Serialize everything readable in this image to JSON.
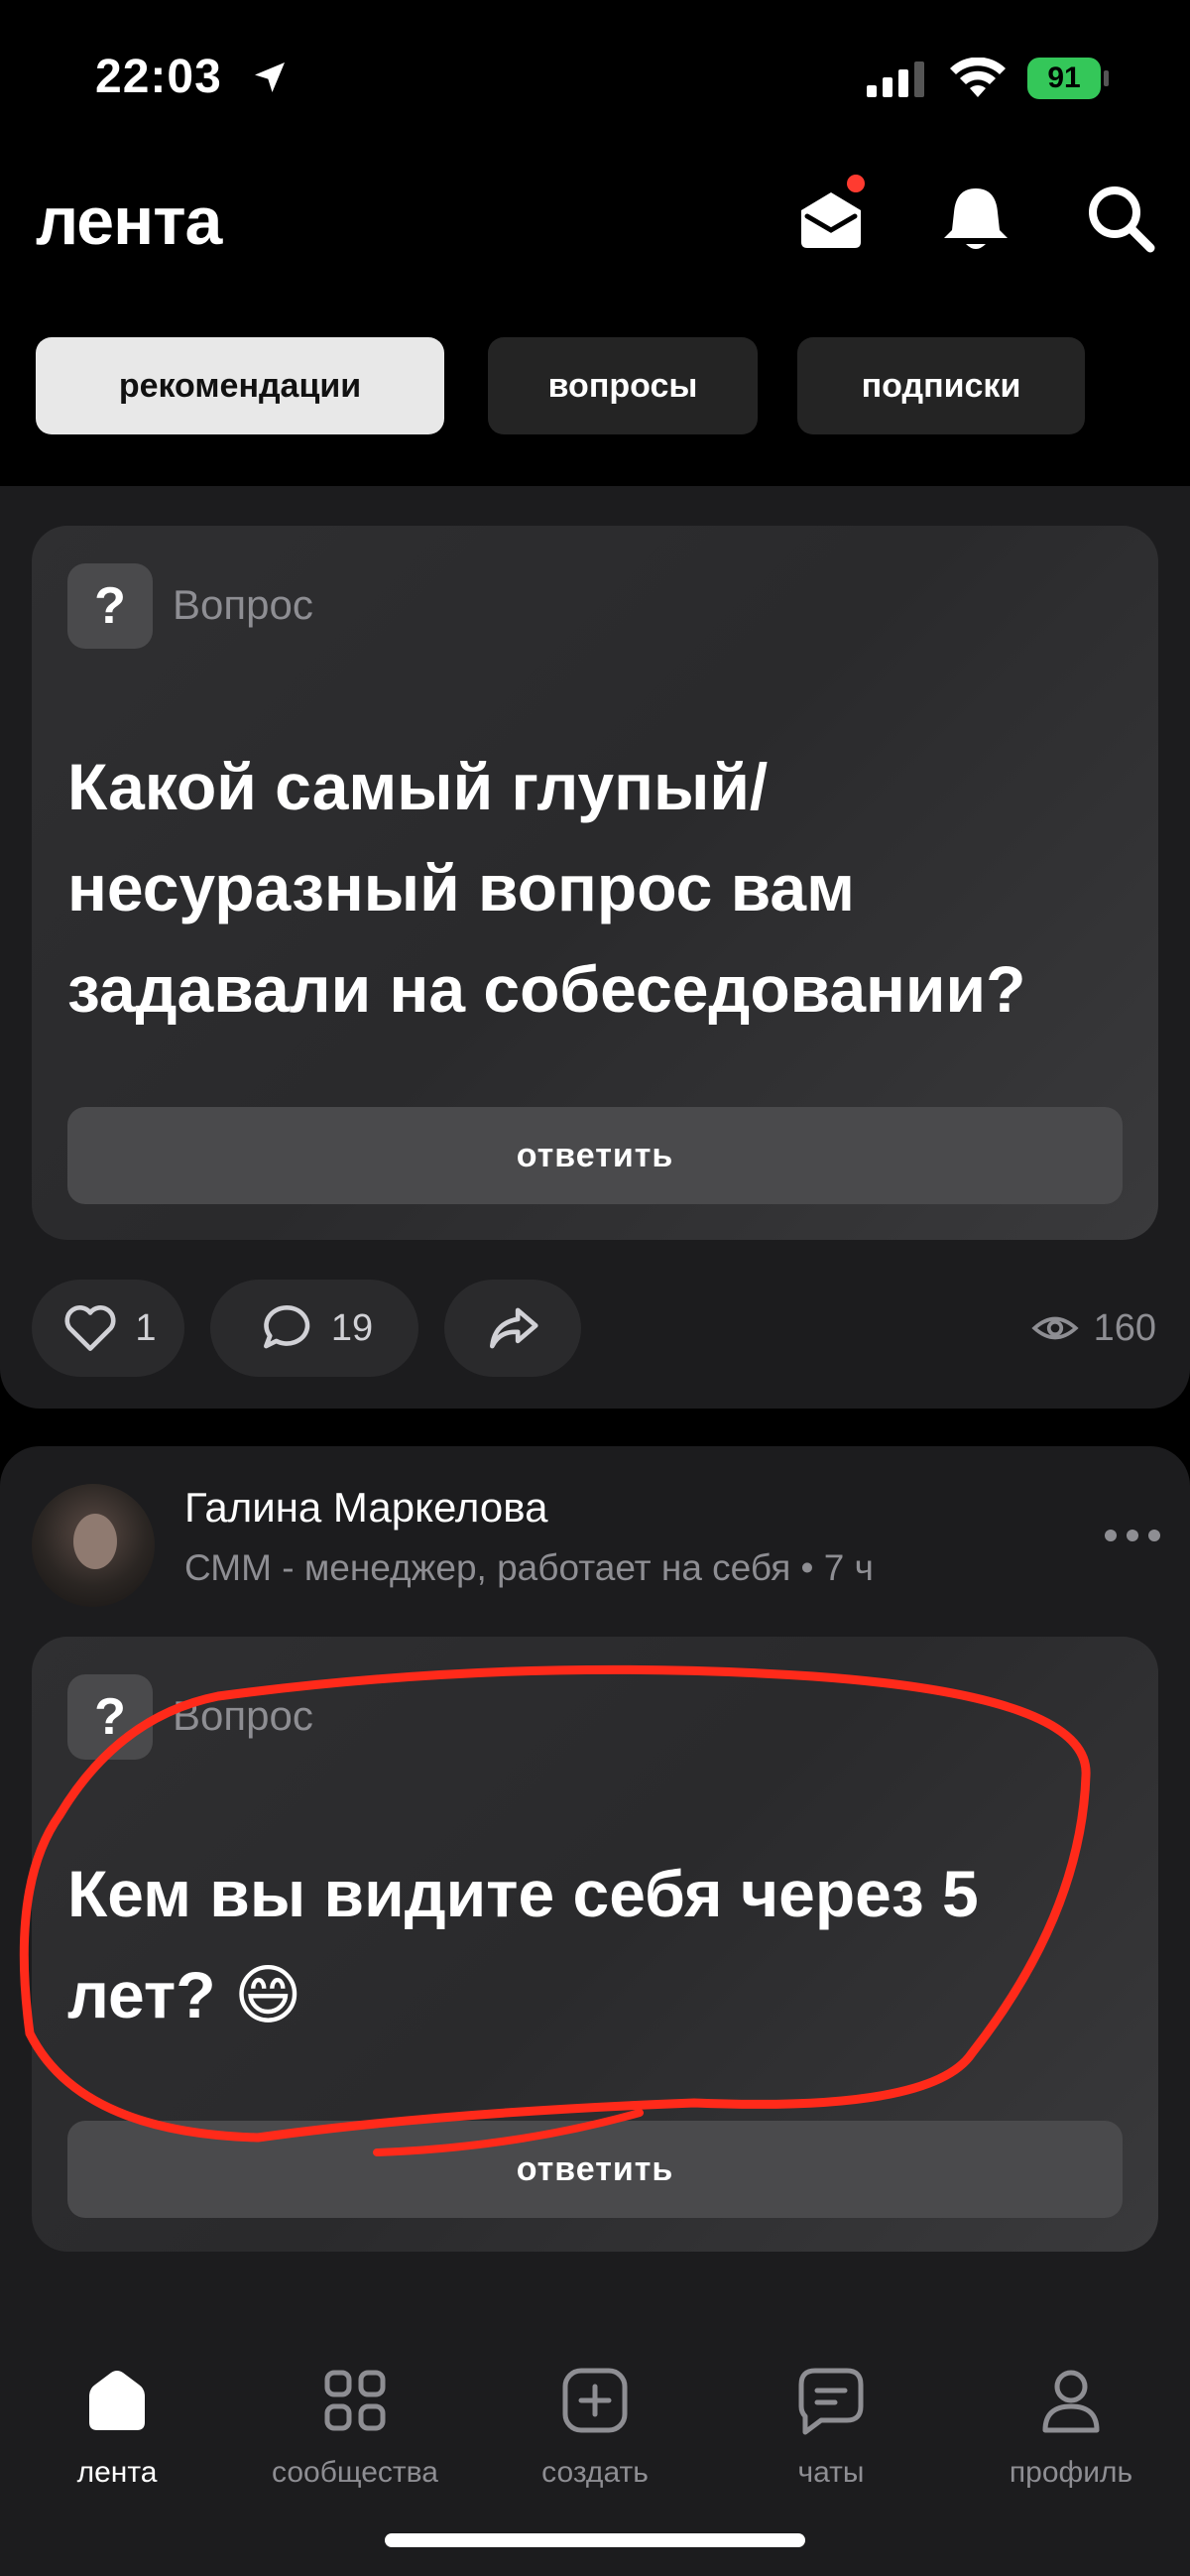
{
  "status_bar": {
    "time": "22:03",
    "battery": "91"
  },
  "header": {
    "logo": "лента",
    "tabs": [
      {
        "label": "рекомендации",
        "active": true
      },
      {
        "label": "вопросы",
        "active": false
      },
      {
        "label": "подписки",
        "active": false
      }
    ]
  },
  "posts": [
    {
      "type_label": "Вопрос",
      "badge": "?",
      "question": "Какой самый глупый/ несуразный вопрос вам задавали на собеседовании?",
      "answer_label": "ответить",
      "likes": "1",
      "comments": "19",
      "views": "160"
    },
    {
      "author": "Галина Маркелова",
      "author_sub": "СММ - менеджер, работает на себя • 7 ч",
      "type_label": "Вопрос",
      "badge": "?",
      "question": "Кем вы видите себя через 5 лет? 😄",
      "answer_label": "ответить"
    }
  ],
  "bottom_nav": [
    {
      "label": "лента",
      "icon": "home-icon",
      "active": true
    },
    {
      "label": "сообщества",
      "icon": "grid-icon",
      "active": false
    },
    {
      "label": "создать",
      "icon": "plus-square-icon",
      "active": false
    },
    {
      "label": "чаты",
      "icon": "chat-icon",
      "active": false
    },
    {
      "label": "профиль",
      "icon": "profile-icon",
      "active": false
    }
  ],
  "colors": {
    "background": "#000000",
    "card": "#1c1c1e",
    "accent_red": "#ff3b30",
    "battery_green": "#34c759"
  }
}
